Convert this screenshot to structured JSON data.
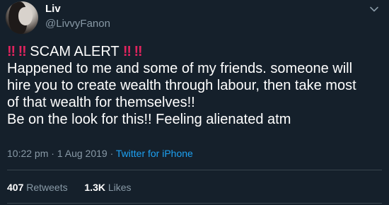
{
  "user": {
    "name": "Liv",
    "handle": "@LivvyFanon"
  },
  "tweet": {
    "alert_marks_left": "‼ ‼",
    "alert_title": "SCAM ALERT",
    "alert_marks_right": "‼ ‼",
    "line2": "Happened to me and some of my friends. someone will",
    "line3": "hire you to create wealth through labour, then take most",
    "line4": "of that wealth for themselves!!",
    "line5": "Be on the look for this!! Feeling alienated atm"
  },
  "meta": {
    "time": "10:22 pm",
    "date": "1 Aug 2019",
    "separator": "·",
    "source": "Twitter for iPhone"
  },
  "stats": {
    "retweets_count": "407",
    "retweets_label": "Retweets",
    "likes_count": "1.3K",
    "likes_label": "Likes"
  },
  "colors": {
    "background": "#15202b",
    "secondary_text": "#8899a6",
    "link": "#1da1f2",
    "alert_marks": "#e0245e"
  },
  "icons": {
    "menu": "chevron-down-icon",
    "alert": "double-exclamation-icon"
  }
}
